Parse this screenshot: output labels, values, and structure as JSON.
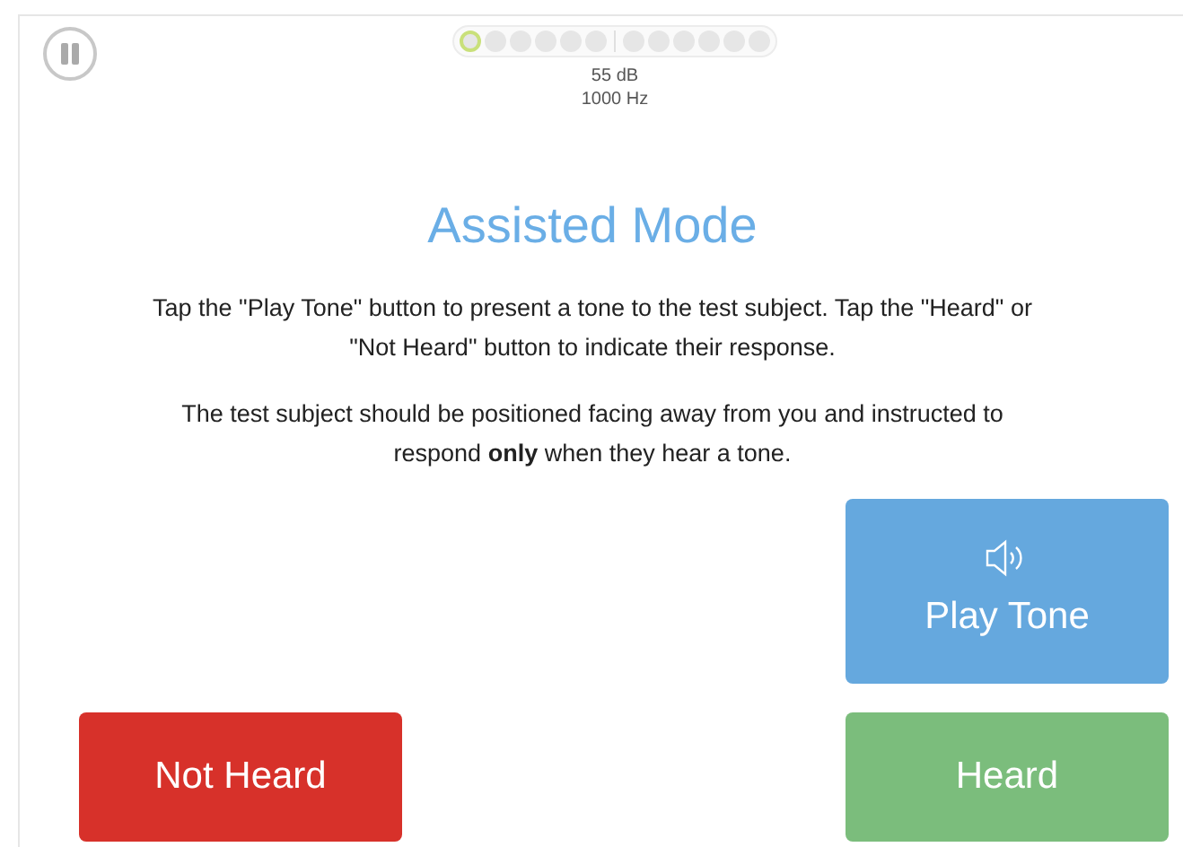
{
  "progress": {
    "groups": [
      [
        {
          "selected": true
        },
        {
          "selected": false
        },
        {
          "selected": false
        },
        {
          "selected": false
        },
        {
          "selected": false
        },
        {
          "selected": false
        }
      ],
      [
        {
          "selected": false
        },
        {
          "selected": false
        },
        {
          "selected": false
        },
        {
          "selected": false
        },
        {
          "selected": false
        },
        {
          "selected": false
        }
      ]
    ]
  },
  "level": "55 dB",
  "frequency": "1000 Hz",
  "title": "Assisted Mode",
  "paragraphs": [
    "Tap the \"Play Tone\" button to present a tone to the test subject. Tap the \"Heard\" or \"Not Heard\" button to indicate their response.",
    "The test subject should be positioned facing away from you and instructed to respond **only** when they hear a tone."
  ],
  "buttons": {
    "play": "Play Tone",
    "not_heard": "Not Heard",
    "heard": "Heard"
  }
}
